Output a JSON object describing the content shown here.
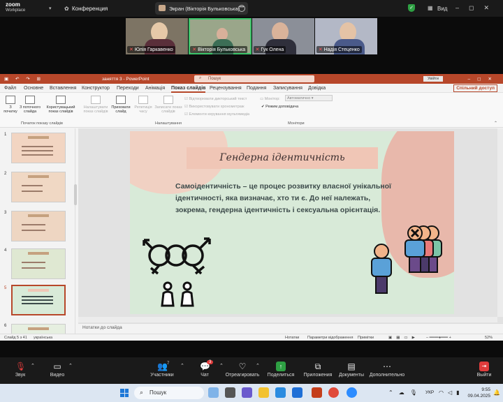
{
  "zoom": {
    "app_name": "zoom",
    "app_subtitle": "Workplace",
    "meeting_menu": "Конференция",
    "screen_share_label": "Экран (Вікторія Бульковська)",
    "view_label": "Вид",
    "participants": [
      {
        "name": "Юлія Гаркавенко",
        "muted": true
      },
      {
        "name": "Вікторія Бульковська",
        "muted": true,
        "active": true
      },
      {
        "name": "Гук Олена",
        "muted": true
      },
      {
        "name": "Надія Стеценко",
        "muted": true
      }
    ],
    "toolbar": {
      "audio": "Звук",
      "video": "Видео",
      "participants": "Участники",
      "participants_count": "7",
      "chat": "Чат",
      "chat_badge": "3",
      "react": "Отреагировать",
      "share": "Поделиться",
      "apps": "Приложения",
      "docs": "Документы",
      "more": "Дополнительно",
      "leave": "Выйти"
    }
  },
  "powerpoint": {
    "doc_title": "заняття 3  -  PowerPoint",
    "search_placeholder": "Пошук",
    "sign_in": "Увійти",
    "share": "Спільний доступ",
    "menu": [
      "Файл",
      "Основне",
      "Вставлення",
      "Конструктор",
      "Переходи",
      "Анімація",
      "Показ слайдів",
      "Рецензування",
      "Подання",
      "Записування",
      "Довідка"
    ],
    "selected_menu": "Показ слайдів",
    "ribbon": {
      "from_start": "З початку",
      "from_current": "З поточного слайда",
      "custom": "Користувацький показ слайдів",
      "group1": "Початок показу слайдів",
      "setup": "Налаштувати показ слайдів",
      "hide": "Приховати слайд",
      "rehearse": "Репетиція часу",
      "record": "Записати показ слайдів",
      "play_narrations": "Відтворювати дикторський текст",
      "use_timings": "Використовувати хронометраж",
      "show_controls": "Елементи керування мультимедіа",
      "group2": "Налаштування",
      "monitor_label": "Монітор:",
      "monitor_value": "Автоматично",
      "presenter_view": "Режим доповідача",
      "group3": "Монітори"
    },
    "slide_numbers": [
      "1",
      "2",
      "3",
      "4",
      "5",
      "6"
    ],
    "selected_slide": 5,
    "slide": {
      "title": "Гендерна ідентичність",
      "body": "Самоідентичність –  це процес розвитку власної унікальної ідентичності, яка визначає, хто ти є. До неї належать, зокрема, гендерна ідентичність і сексуальна орієнтація."
    },
    "notes_placeholder": "Нотатки до слайда",
    "status": {
      "slide_of": "Слайд 5 з 41",
      "language": "українська",
      "notes": "Нотатки",
      "display_settings": "Параметри відображення",
      "comments": "Примітки",
      "zoom": "52%"
    }
  },
  "taskbar": {
    "search": "Пошук",
    "lang": "УКР",
    "time": "9:55",
    "date": "09.04.2025"
  }
}
